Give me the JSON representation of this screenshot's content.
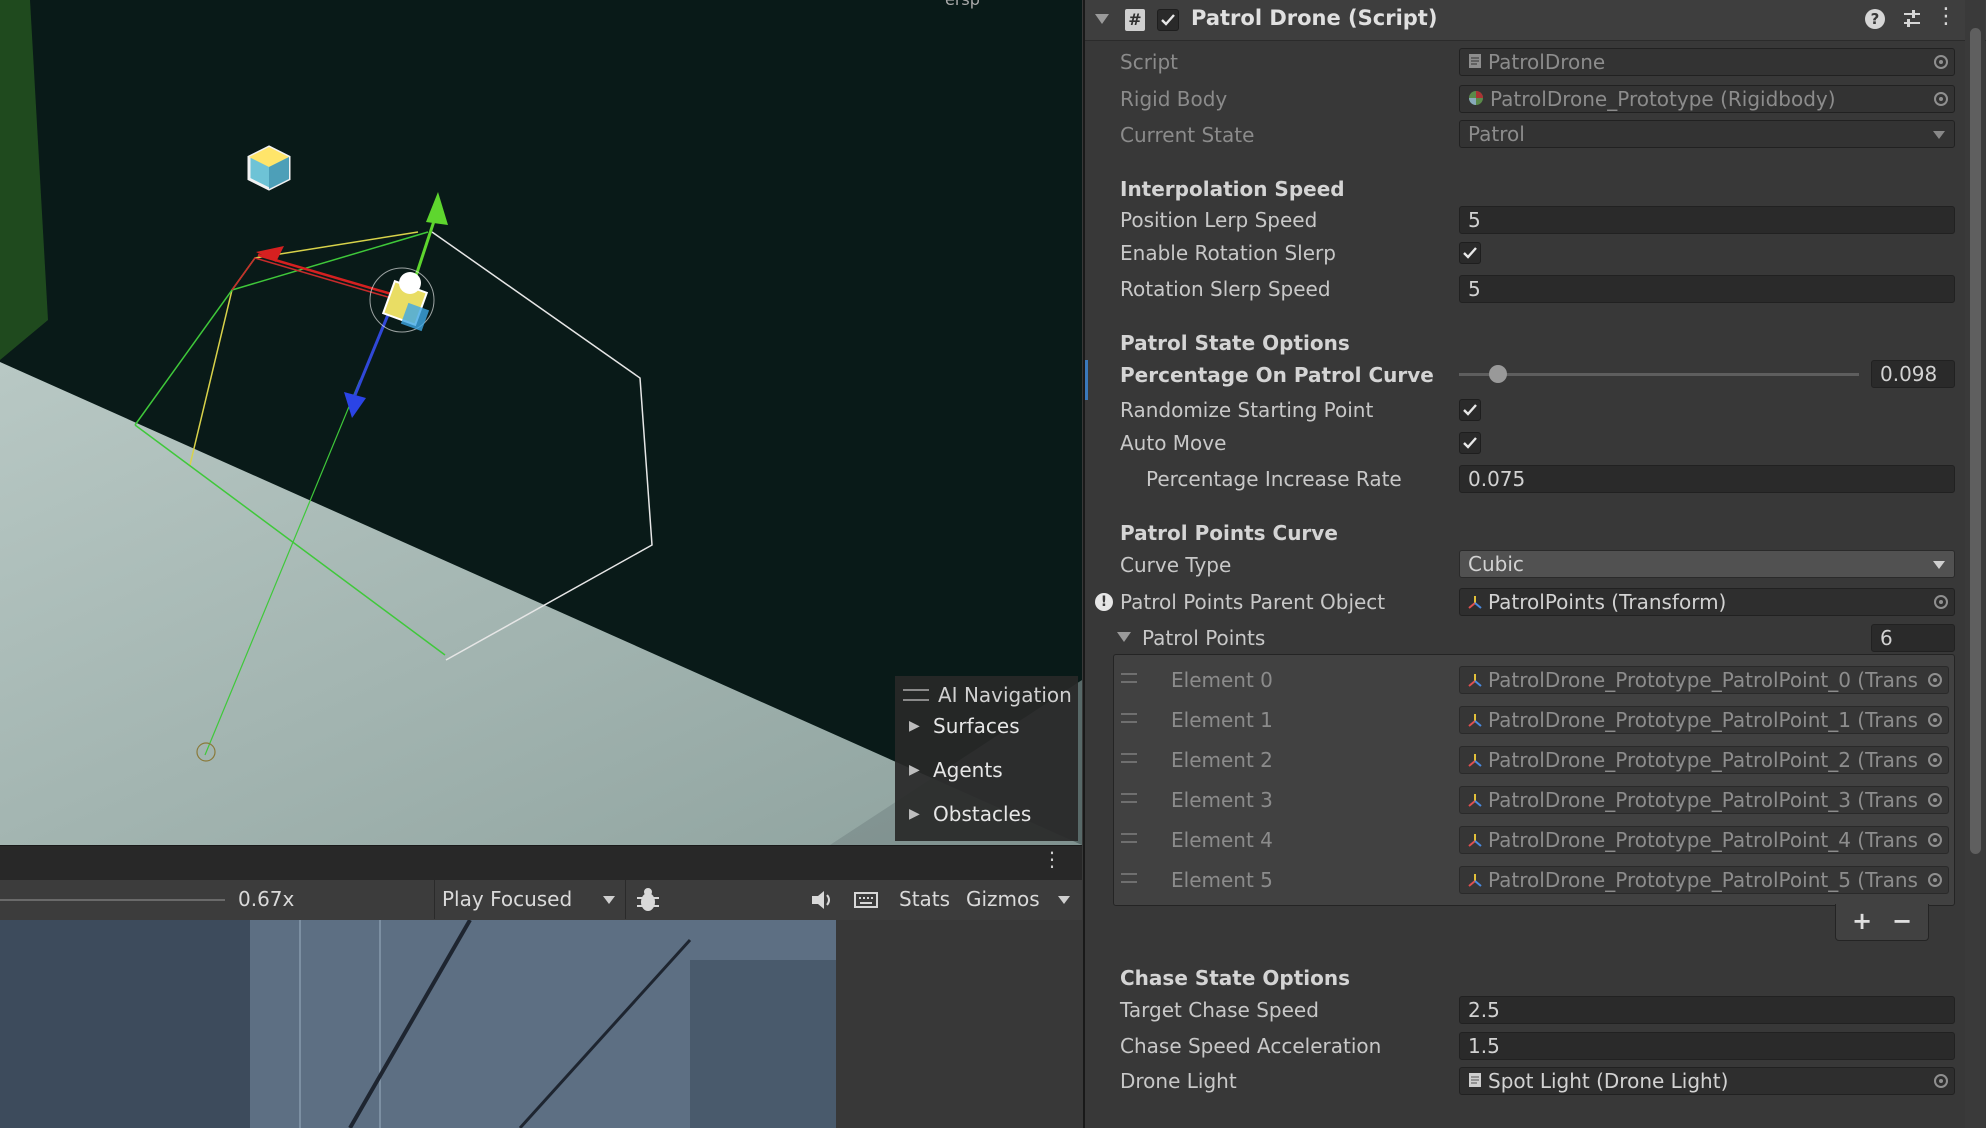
{
  "scene": {
    "corner_text": "ersp",
    "ai_nav": {
      "title": "AI Navigation",
      "items": [
        "Surfaces",
        "Agents",
        "Obstacles"
      ]
    }
  },
  "game_toolbar": {
    "scale_value": "0.67x",
    "play_mode": "Play Focused",
    "stats_label": "Stats",
    "gizmos_label": "Gizmos"
  },
  "inspector": {
    "component_title": "Patrol Drone (Script)",
    "rows": {
      "script_label": "Script",
      "script_value": "PatrolDrone",
      "rigidbody_label": "Rigid Body",
      "rigidbody_value": "PatrolDrone_Prototype (Rigidbody)",
      "state_label": "Current State",
      "state_value": "Patrol"
    },
    "interpolation": {
      "header": "Interpolation Speed",
      "pos_label": "Position Lerp Speed",
      "pos_value": "5",
      "enable_rot_label": "Enable Rotation Slerp",
      "rot_label": "Rotation Slerp Speed",
      "rot_value": "5"
    },
    "patrol_state": {
      "header": "Patrol State Options",
      "pct_label": "Percentage On Patrol Curve",
      "pct_value": "0.098",
      "pct_fraction": 0.098,
      "randomize_label": "Randomize Starting Point",
      "auto_move_label": "Auto Move",
      "increase_label": "Percentage Increase Rate",
      "increase_value": "0.075"
    },
    "patrol_curve": {
      "header": "Patrol Points Curve",
      "curve_type_label": "Curve Type",
      "curve_type_value": "Cubic",
      "parent_label": "Patrol Points Parent Object",
      "parent_value": "PatrolPoints (Transform)",
      "points_label": "Patrol Points",
      "points_count": "6",
      "elements": [
        {
          "label": "Element 0",
          "value": "PatrolDrone_Prototype_PatrolPoint_0 (Trans"
        },
        {
          "label": "Element 1",
          "value": "PatrolDrone_Prototype_PatrolPoint_1 (Trans"
        },
        {
          "label": "Element 2",
          "value": "PatrolDrone_Prototype_PatrolPoint_2 (Trans"
        },
        {
          "label": "Element 3",
          "value": "PatrolDrone_Prototype_PatrolPoint_3 (Trans"
        },
        {
          "label": "Element 4",
          "value": "PatrolDrone_Prototype_PatrolPoint_4 (Trans"
        },
        {
          "label": "Element 5",
          "value": "PatrolDrone_Prototype_PatrolPoint_5 (Trans"
        }
      ],
      "add_label": "+",
      "remove_label": "−"
    },
    "chase": {
      "header": "Chase State Options",
      "target_label": "Target Chase Speed",
      "target_value": "2.5",
      "accel_label": "Chase Speed Acceleration",
      "accel_value": "1.5",
      "light_label": "Drone Light",
      "light_value": "Spot Light (Drone Light)"
    }
  },
  "colors": {
    "scene_bg": "#091a18",
    "ground": "#9fb1ad",
    "inspector_bg": "#383838",
    "accent_blue": "#3a79bb"
  }
}
